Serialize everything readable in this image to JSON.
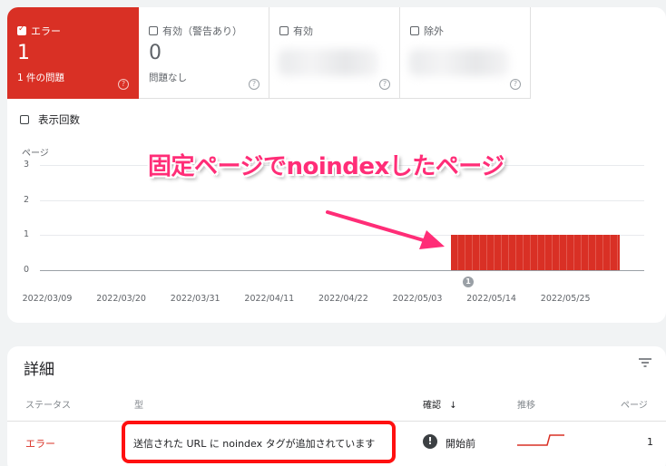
{
  "tiles": [
    {
      "label": "エラー",
      "count": "1",
      "sub": "1 件の問題",
      "help": "?",
      "active": true
    },
    {
      "label": "有効（警告あり）",
      "count": "0",
      "sub": "問題なし",
      "help": "?"
    },
    {
      "label": "有効",
      "help": "?"
    },
    {
      "label": "除外",
      "help": "?"
    }
  ],
  "impressions_label": "表示回数",
  "annotation": "固定ページでnoindexしたページ",
  "chart_data": {
    "type": "bar",
    "ylabel": "ページ",
    "yticks": [
      "3",
      "2",
      "1",
      "0"
    ],
    "ylim": [
      0,
      3
    ],
    "xticks": [
      "2022/03/09",
      "2022/03/20",
      "2022/03/31",
      "2022/04/11",
      "2022/04/22",
      "2022/05/03",
      "2022/05/14",
      "2022/05/25"
    ],
    "series": [
      {
        "start": "2022/05/08",
        "end": "2022/06/02",
        "value": 1
      }
    ],
    "marker": "1",
    "color": "#d93025"
  },
  "details": {
    "title": "詳細",
    "columns": {
      "status": "ステータス",
      "type": "型",
      "validation": "確認",
      "trend": "推移",
      "pages": "ページ"
    },
    "rows": [
      {
        "status": "エラー",
        "type": "送信された URL に noindex タグが追加されています",
        "validation": "開始前",
        "pages": "1"
      }
    ]
  }
}
